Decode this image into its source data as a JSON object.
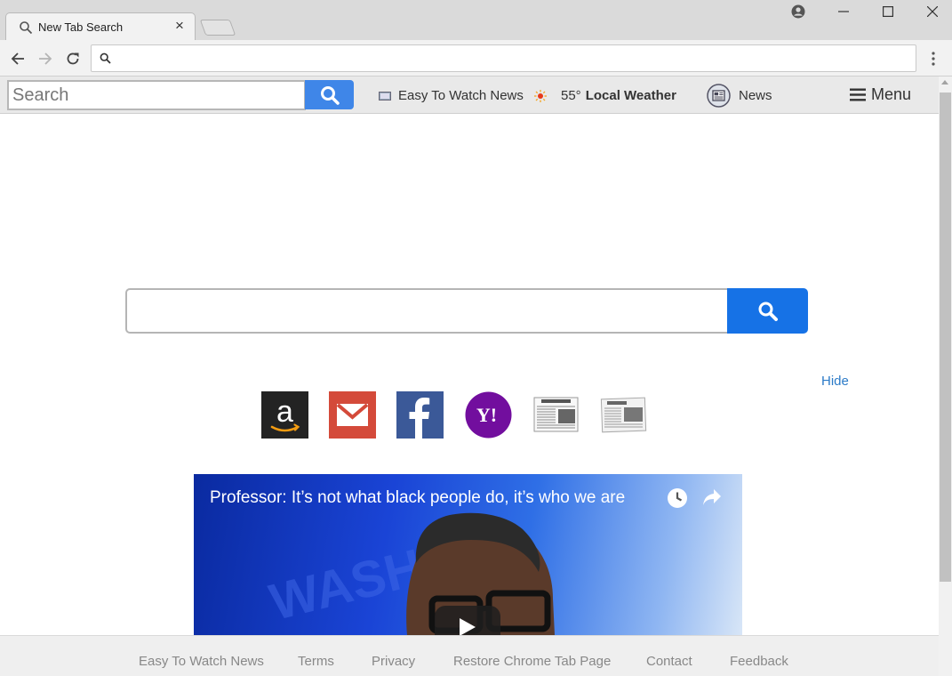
{
  "browser": {
    "tab_title": "New Tab Search",
    "tab_close": "×",
    "url": ""
  },
  "extension_bar": {
    "search_placeholder": "Search",
    "links": {
      "watch_news": "Easy To Watch News",
      "temperature": "55°",
      "weather": "Local Weather",
      "news": "News"
    },
    "menu_label": "Menu"
  },
  "main": {
    "search_value": "",
    "hide_label": "Hide",
    "quick_links": [
      "amazon",
      "gmail",
      "facebook",
      "yahoo",
      "newspaper",
      "daily-news"
    ],
    "video": {
      "title": "Professor: It’s not what black people do, it’s who we are"
    }
  },
  "footer": {
    "links": [
      "Easy To Watch News",
      "Terms",
      "Privacy",
      "Restore Chrome Tab Page",
      "Contact",
      "Feedback"
    ]
  },
  "colors": {
    "accent_blue": "#1672e6",
    "ext_search_blue": "#3f86e8",
    "hide_link": "#2c7bc8",
    "facebook": "#3b5998",
    "gmail": "#d44a3a",
    "yahoo": "#720e9e"
  }
}
